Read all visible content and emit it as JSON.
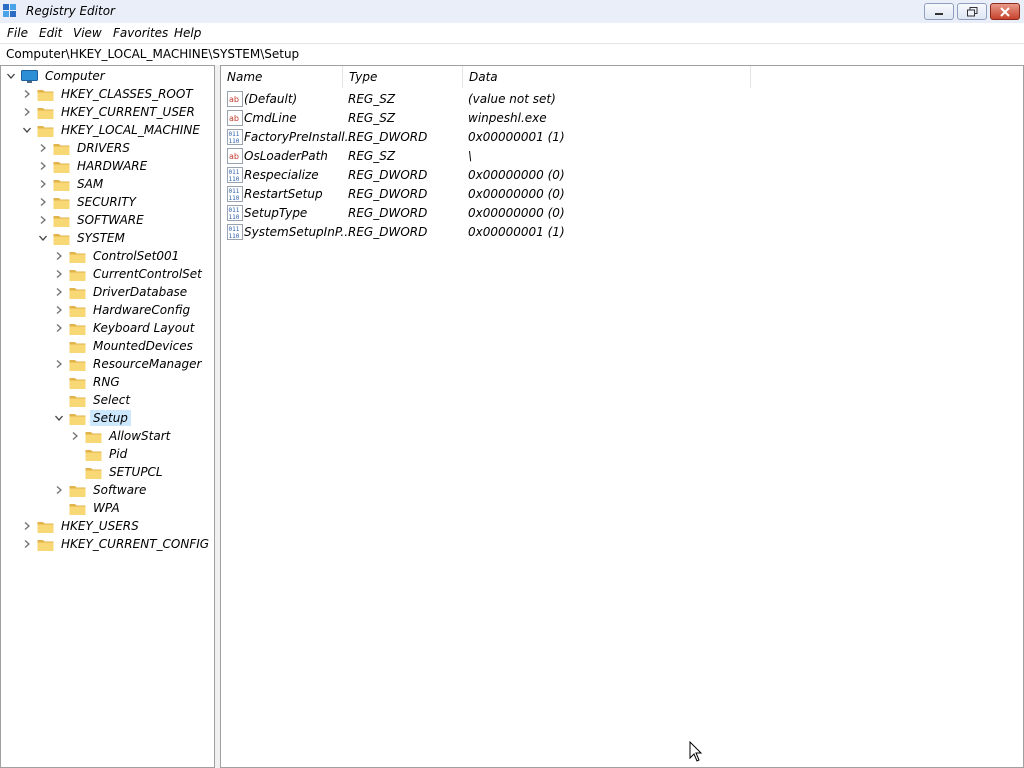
{
  "window": {
    "title": "Registry Editor",
    "controls": {
      "minimize": "minimize",
      "maximize": "restore",
      "close": "close"
    }
  },
  "menu": {
    "items": [
      {
        "label": "File"
      },
      {
        "label": "Edit"
      },
      {
        "label": "View"
      },
      {
        "label": "Favorites"
      },
      {
        "label": "Help"
      }
    ]
  },
  "address": {
    "path": "Computer\\HKEY_LOCAL_MACHINE\\SYSTEM\\Setup"
  },
  "tree": {
    "items": [
      {
        "label": "Computer",
        "level": 0,
        "expander": "expanded",
        "icon": "computer-icon"
      },
      {
        "label": "HKEY_CLASSES_ROOT",
        "level": 1,
        "expander": "collapsed",
        "icon": "folder-icon"
      },
      {
        "label": "HKEY_CURRENT_USER",
        "level": 1,
        "expander": "collapsed",
        "icon": "folder-icon"
      },
      {
        "label": "HKEY_LOCAL_MACHINE",
        "level": 1,
        "expander": "expanded",
        "icon": "folder-icon"
      },
      {
        "label": "DRIVERS",
        "level": 2,
        "expander": "collapsed",
        "icon": "folder-icon"
      },
      {
        "label": "HARDWARE",
        "level": 2,
        "expander": "collapsed",
        "icon": "folder-icon"
      },
      {
        "label": "SAM",
        "level": 2,
        "expander": "collapsed",
        "icon": "folder-icon"
      },
      {
        "label": "SECURITY",
        "level": 2,
        "expander": "collapsed",
        "icon": "folder-icon"
      },
      {
        "label": "SOFTWARE",
        "level": 2,
        "expander": "collapsed",
        "icon": "folder-icon"
      },
      {
        "label": "SYSTEM",
        "level": 2,
        "expander": "expanded",
        "icon": "folder-icon"
      },
      {
        "label": "ControlSet001",
        "level": 3,
        "expander": "collapsed",
        "icon": "folder-icon"
      },
      {
        "label": "CurrentControlSet",
        "level": 3,
        "expander": "collapsed",
        "icon": "folder-icon"
      },
      {
        "label": "DriverDatabase",
        "level": 3,
        "expander": "collapsed",
        "icon": "folder-icon"
      },
      {
        "label": "HardwareConfig",
        "level": 3,
        "expander": "collapsed",
        "icon": "folder-icon"
      },
      {
        "label": "Keyboard Layout",
        "level": 3,
        "expander": "collapsed",
        "icon": "folder-icon"
      },
      {
        "label": "MountedDevices",
        "level": 3,
        "expander": "none",
        "icon": "folder-icon"
      },
      {
        "label": "ResourceManager",
        "level": 3,
        "expander": "collapsed",
        "icon": "folder-icon"
      },
      {
        "label": "RNG",
        "level": 3,
        "expander": "none",
        "icon": "folder-icon"
      },
      {
        "label": "Select",
        "level": 3,
        "expander": "none",
        "icon": "folder-icon"
      },
      {
        "label": "Setup",
        "level": 3,
        "expander": "expanded",
        "icon": "folder-open-icon",
        "selected": true
      },
      {
        "label": "AllowStart",
        "level": 4,
        "expander": "collapsed",
        "icon": "folder-icon"
      },
      {
        "label": "Pid",
        "level": 4,
        "expander": "none",
        "icon": "folder-icon"
      },
      {
        "label": "SETUPCL",
        "level": 4,
        "expander": "none",
        "icon": "folder-icon"
      },
      {
        "label": "Software",
        "level": 3,
        "expander": "collapsed",
        "icon": "folder-icon"
      },
      {
        "label": "WPA",
        "level": 3,
        "expander": "none",
        "icon": "folder-icon"
      },
      {
        "label": "HKEY_USERS",
        "level": 1,
        "expander": "collapsed",
        "icon": "folder-icon"
      },
      {
        "label": "HKEY_CURRENT_CONFIG",
        "level": 1,
        "expander": "collapsed",
        "icon": "folder-icon"
      }
    ]
  },
  "list": {
    "columns": [
      {
        "label": "Name"
      },
      {
        "label": "Type"
      },
      {
        "label": "Data"
      }
    ],
    "rows": [
      {
        "name": "(Default)",
        "type": "REG_SZ",
        "data": "(value not set)",
        "icon": "string-value-icon"
      },
      {
        "name": "CmdLine",
        "type": "REG_SZ",
        "data": "winpeshl.exe",
        "icon": "string-value-icon"
      },
      {
        "name": "FactoryPreInstall...",
        "type": "REG_DWORD",
        "data": "0x00000001 (1)",
        "icon": "binary-value-icon"
      },
      {
        "name": "OsLoaderPath",
        "type": "REG_SZ",
        "data": "\\",
        "icon": "string-value-icon"
      },
      {
        "name": "Respecialize",
        "type": "REG_DWORD",
        "data": "0x00000000 (0)",
        "icon": "binary-value-icon"
      },
      {
        "name": "RestartSetup",
        "type": "REG_DWORD",
        "data": "0x00000000 (0)",
        "icon": "binary-value-icon"
      },
      {
        "name": "SetupType",
        "type": "REG_DWORD",
        "data": "0x00000000 (0)",
        "icon": "binary-value-icon"
      },
      {
        "name": "SystemSetupInP...",
        "type": "REG_DWORD",
        "data": "0x00000001 (1)",
        "icon": "binary-value-icon"
      }
    ]
  },
  "colors": {
    "selection": "#cce8ff",
    "folder": "#f8d775",
    "folder_dark": "#e2b34a",
    "string_icon": "#c0392b",
    "binary_icon": "#2b5fa8"
  }
}
